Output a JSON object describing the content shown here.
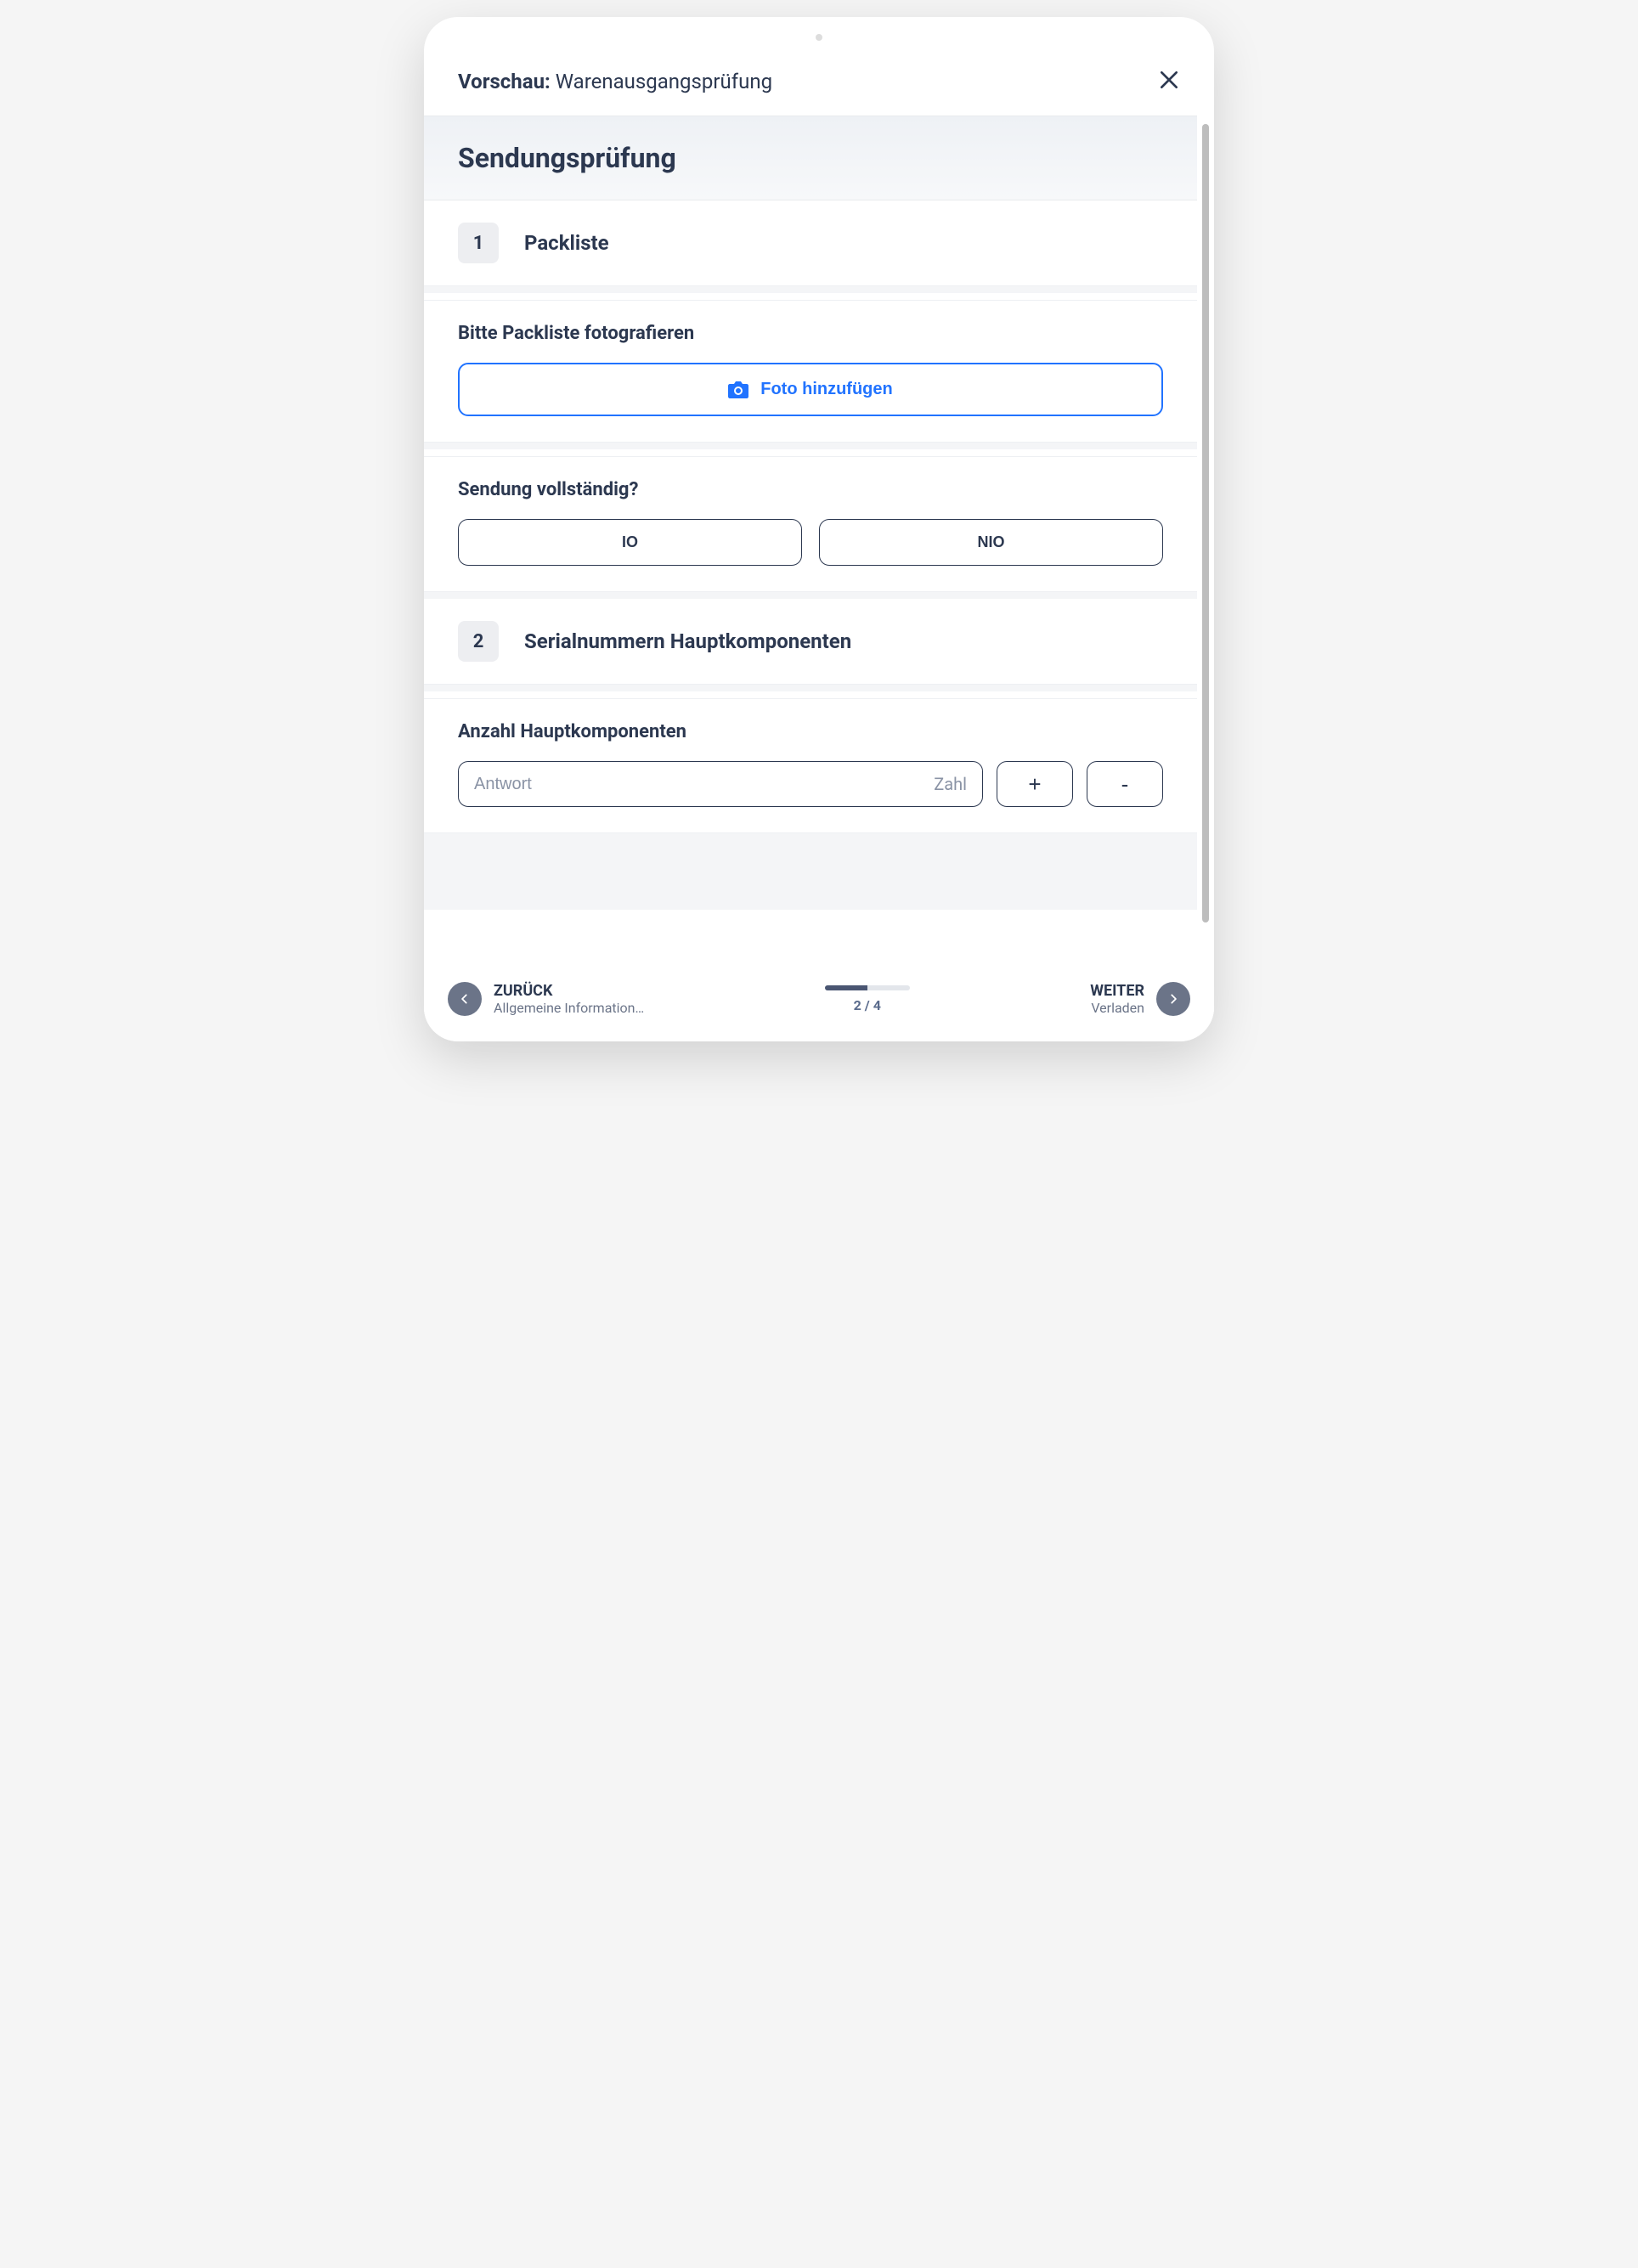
{
  "header": {
    "title_prefix": "Vorschau:",
    "title_name": "Warenausgangsprüfung"
  },
  "section": {
    "title": "Sendungsprüfung"
  },
  "steps": [
    {
      "number": "1",
      "title": "Packliste",
      "items": [
        {
          "type": "photo",
          "label": "Bitte Packliste fotografieren",
          "button": "Foto hinzufügen"
        },
        {
          "type": "choice",
          "label": "Sendung vollständig?",
          "options": [
            "IO",
            "NIO"
          ]
        }
      ]
    },
    {
      "number": "2",
      "title": "Serialnummern Hauptkomponenten",
      "items": [
        {
          "type": "number",
          "label": "Anzahl Hauptkomponenten",
          "placeholder": "Antwort",
          "unit": "Zahl",
          "plus": "+",
          "minus": "-"
        }
      ]
    }
  ],
  "footer": {
    "back": {
      "label": "ZURÜCK",
      "sub": "Allgemeine Information…"
    },
    "progress": {
      "current": 2,
      "total": 4,
      "text": "2 / 4"
    },
    "forward": {
      "label": "WEITER",
      "sub": "Verladen"
    }
  }
}
